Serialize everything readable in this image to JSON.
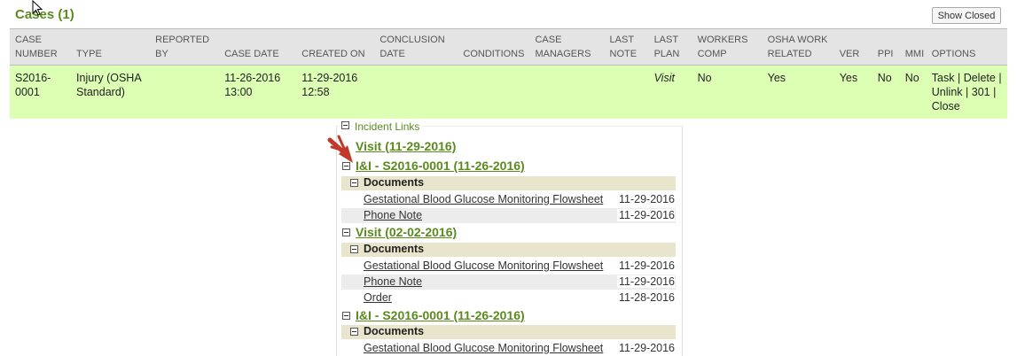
{
  "header": {
    "title": "Cases (1)",
    "show_closed_label": "Show Closed"
  },
  "table": {
    "columns": [
      "CASE NUMBER",
      "TYPE",
      "REPORTED BY",
      "CASE DATE",
      "CREATED ON",
      "CONCLUSION DATE",
      "CONDITIONS",
      "CASE MANAGERS",
      "LAST NOTE",
      "LAST PLAN",
      "WORKERS COMP",
      "OSHA WORK RELATED",
      "VER",
      "PPI",
      "MMI",
      "OPTIONS"
    ],
    "row": {
      "case_number": "S2016-0001",
      "type": "Injury (OSHA Standard)",
      "reported_by": "",
      "case_date": "11-26-2016 13:00",
      "created_on": "11-29-2016 12:58",
      "conclusion_date": "",
      "conditions": "",
      "case_managers": "",
      "last_note": "",
      "last_plan": "Visit",
      "workers_comp": "No",
      "osha_work_related": "Yes",
      "ver": "Yes",
      "ppi": "No",
      "mmi": "No",
      "options": {
        "task": "Task",
        "delete": "Delete",
        "unlink": "Unlink",
        "num": "301",
        "close": "Close",
        "sep": "|"
      }
    }
  },
  "incident_links": {
    "title": "Incident Links",
    "sections": [
      {
        "label": "Visit (11-29-2016)"
      },
      {
        "label": "I&I - S2016-0001 (11-26-2016)"
      },
      {
        "label": "Visit (02-02-2016)"
      },
      {
        "label": "I&I - S2016-0001 (11-26-2016)"
      }
    ],
    "documents_label": "Documents",
    "doc_groups": [
      [
        {
          "name": "Gestational Blood Glucose Monitoring Flowsheet",
          "date": "11-29-2016"
        },
        {
          "name": "Phone Note",
          "date": "11-29-2016"
        }
      ],
      [
        {
          "name": "Gestational Blood Glucose Monitoring Flowsheet",
          "date": "11-29-2016"
        },
        {
          "name": "Phone Note",
          "date": "11-29-2016"
        },
        {
          "name": "Order",
          "date": "11-28-2016"
        }
      ],
      [
        {
          "name": "Gestational Blood Glucose Monitoring Flowsheet",
          "date": "11-29-2016"
        }
      ]
    ]
  },
  "colors": {
    "accent_green": "#5a8a1e",
    "row_highlight": "#dcffb4",
    "header_gray": "#e4e4e4",
    "docs_bar": "#e9e4cc",
    "arrow_red": "#c0392b"
  },
  "icons": {
    "cursor": "mouse-pointer-icon",
    "collapse": "minus-box-icon",
    "annotation": "red-arrow-icon"
  }
}
